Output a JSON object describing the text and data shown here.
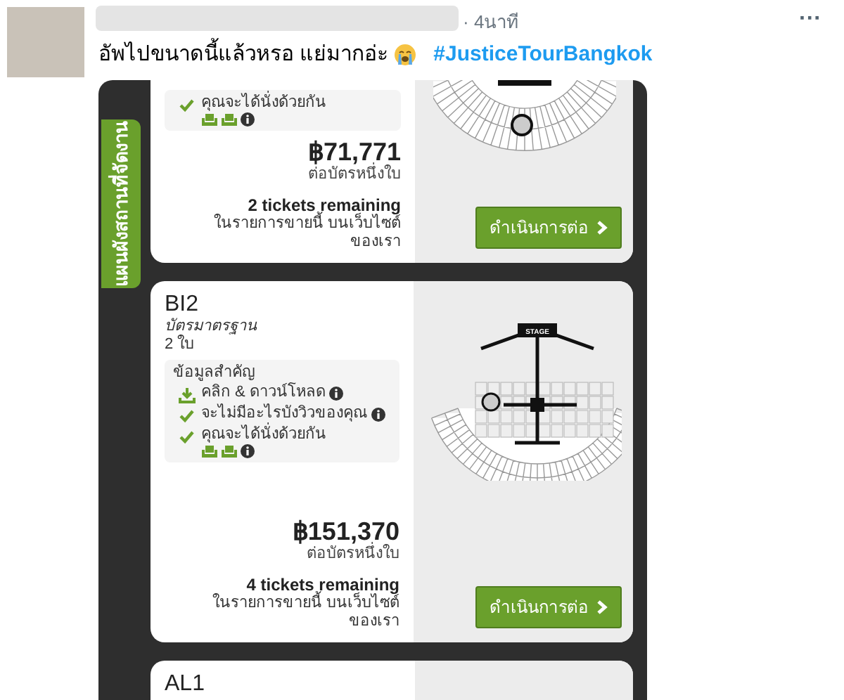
{
  "tweet": {
    "time": "· 4นาที",
    "text": "อัพไปขนาดนี้แล้วหรอ แย่มากอ่ะ",
    "hashtag": "#JusticeTourBangkok",
    "menu": "···"
  },
  "listing_page": {
    "side_tab": "แผนผังสถานที่จัดงาน",
    "listings": [
      {
        "features": [
          {
            "kind": "check",
            "text": "คุณจะได้นั่งด้วยกัน",
            "info": false,
            "seat_icons": true
          }
        ],
        "price": "฿71,771",
        "price_note": "ต่อบัตรหนึ่งใบ",
        "remaining": "2 tickets remaining",
        "remaining_note": "ในรายการขายนี้ บนเว็บไซต์ของเรา",
        "button": "ดำเนินการต่อ",
        "kind": "upper_map"
      },
      {
        "section": "BI2",
        "ticket_type": "บัตรมาตรฐาน",
        "quantity": "2 ใบ",
        "info_title": "ข้อมูลสำคัญ",
        "features": [
          {
            "kind": "download",
            "text": "คลิก & ดาวน์โหลด",
            "info": true,
            "seat_icons": false
          },
          {
            "kind": "check",
            "text": "จะไม่มีอะไรบังวิวของคุณ",
            "info": true,
            "seat_icons": false
          },
          {
            "kind": "check",
            "text": "คุณจะได้นั่งด้วยกัน",
            "info": false,
            "seat_icons": true
          }
        ],
        "price": "฿151,370",
        "price_note": "ต่อบัตรหนึ่งใบ",
        "remaining": "4 tickets remaining",
        "remaining_note": "ในรายการขายนี้ บนเว็บไซต์ของเรา",
        "button": "ดำเนินการต่อ",
        "kind": "full_map",
        "stage_label": "STAGE"
      },
      {
        "section": "AL1",
        "kind": "header_only"
      }
    ]
  }
}
